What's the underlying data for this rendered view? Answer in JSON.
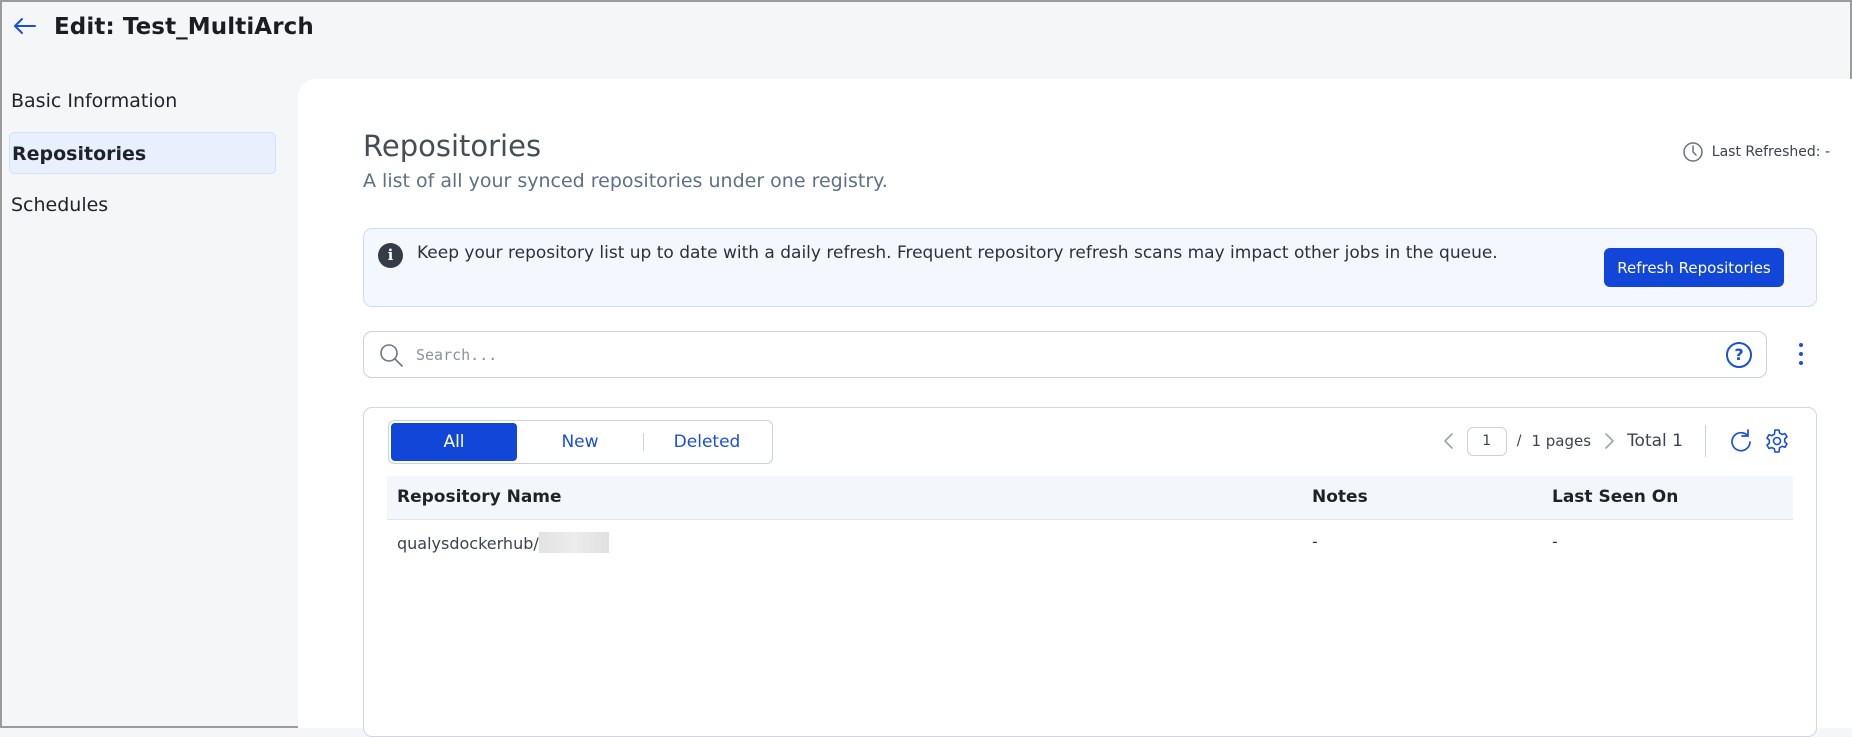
{
  "header": {
    "title": "Edit: Test_MultiArch"
  },
  "sidebar": {
    "items": [
      {
        "label": "Basic Information",
        "active": false
      },
      {
        "label": "Repositories",
        "active": true
      },
      {
        "label": "Schedules",
        "active": false
      }
    ]
  },
  "section": {
    "title": "Repositories",
    "subtitle": "A list of all your synced repositories under one registry.",
    "last_refreshed": "Last Refreshed: -"
  },
  "banner": {
    "text": "Keep your repository list up to date with a daily refresh. Frequent repository refresh scans may impact other jobs in the queue.",
    "button_label": "Refresh Repositories"
  },
  "search": {
    "placeholder": "Search...",
    "value": ""
  },
  "filters": {
    "tabs": [
      "All",
      "New",
      "Deleted"
    ],
    "selected": "All"
  },
  "pagination": {
    "current_page": "1",
    "separator": "/",
    "pages_label": "1 pages",
    "total_label": "Total 1"
  },
  "table": {
    "columns": [
      "Repository Name",
      "Notes",
      "Last Seen On"
    ],
    "rows": [
      {
        "repository_name": "qualysdockerhub/",
        "notes": "-",
        "last_seen_on": "-"
      }
    ]
  },
  "colors": {
    "accent": "#1146d8",
    "link": "#1a4fd6",
    "active_nav_bg": "#e9f0fd",
    "banner_bg": "#f4f7fd"
  },
  "icons": {
    "back": "arrow-left-icon",
    "clock": "clock-icon",
    "info": "info-icon",
    "search": "search-icon",
    "help": "question-circle-icon",
    "more": "kebab-icon",
    "prev": "chevron-left-icon",
    "next": "chevron-right-icon",
    "refresh": "refresh-icon",
    "settings": "gear-icon"
  }
}
